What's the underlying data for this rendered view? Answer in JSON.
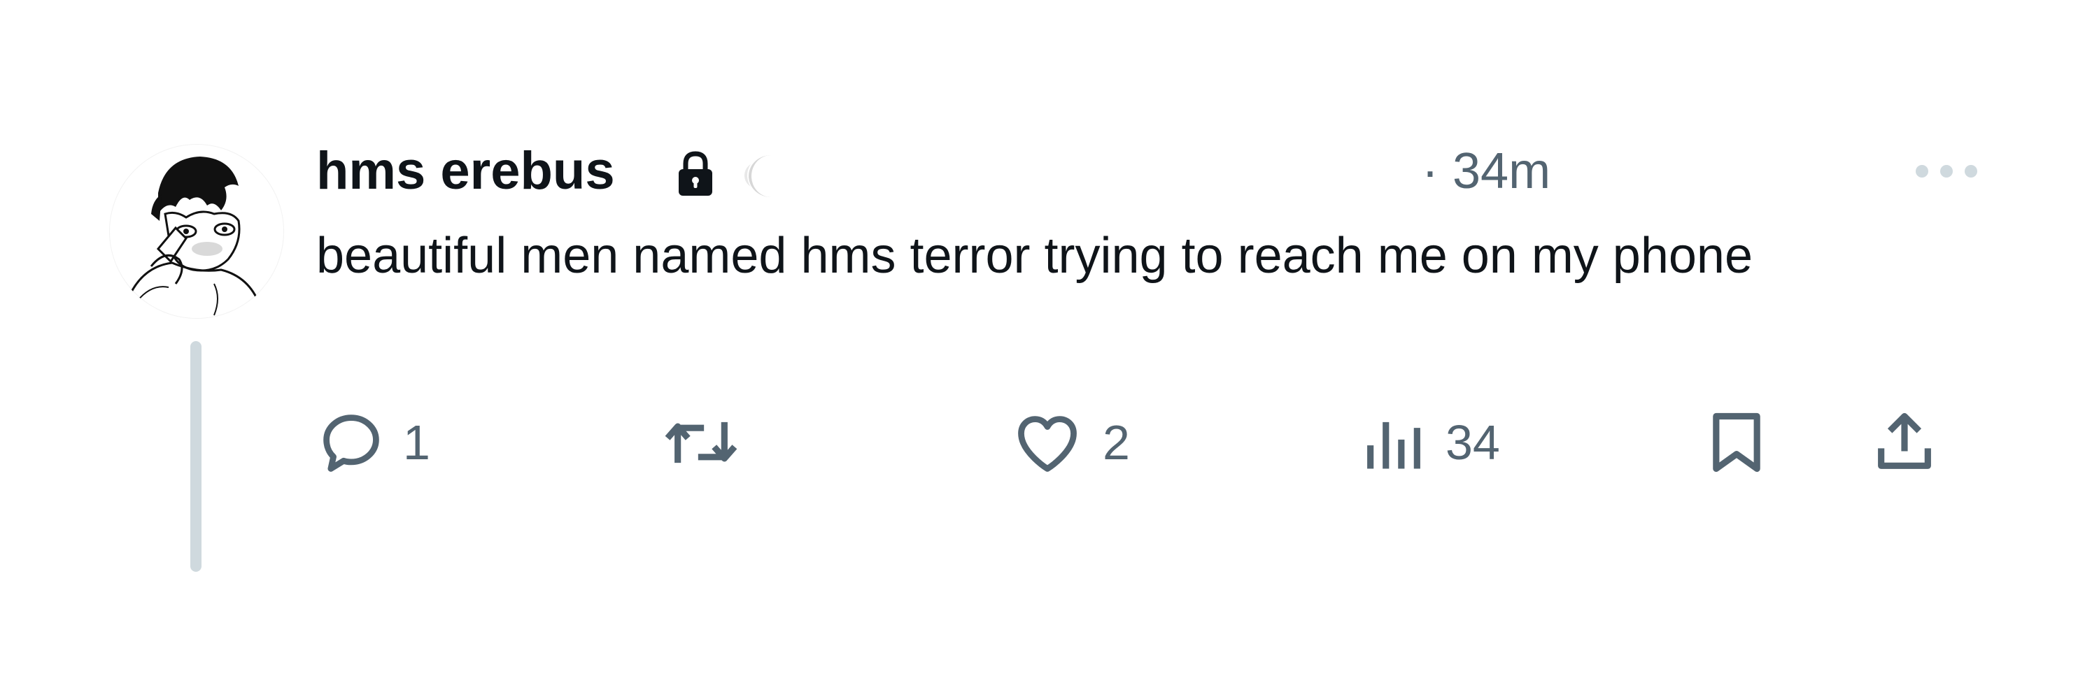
{
  "tweet": {
    "display_name": "hms erebus",
    "timestamp": "· 34m",
    "text": "beautiful men named hms terror trying to reach me on my phone",
    "avatar_icon": "avatar-illustration",
    "lock_icon": "lock-icon",
    "more_icon": "more-icon"
  },
  "actions": {
    "reply": {
      "icon": "reply-icon",
      "count": "1"
    },
    "retweet": {
      "icon": "retweet-icon",
      "count": ""
    },
    "like": {
      "icon": "heart-icon",
      "count": "2"
    },
    "views": {
      "icon": "views-icon",
      "count": "34"
    },
    "bookmark": {
      "icon": "bookmark-icon"
    },
    "share": {
      "icon": "share-icon"
    }
  },
  "colors": {
    "text": "#0f1419",
    "secondary": "#536471",
    "thread_line": "#cfd9de",
    "background": "#ffffff"
  }
}
